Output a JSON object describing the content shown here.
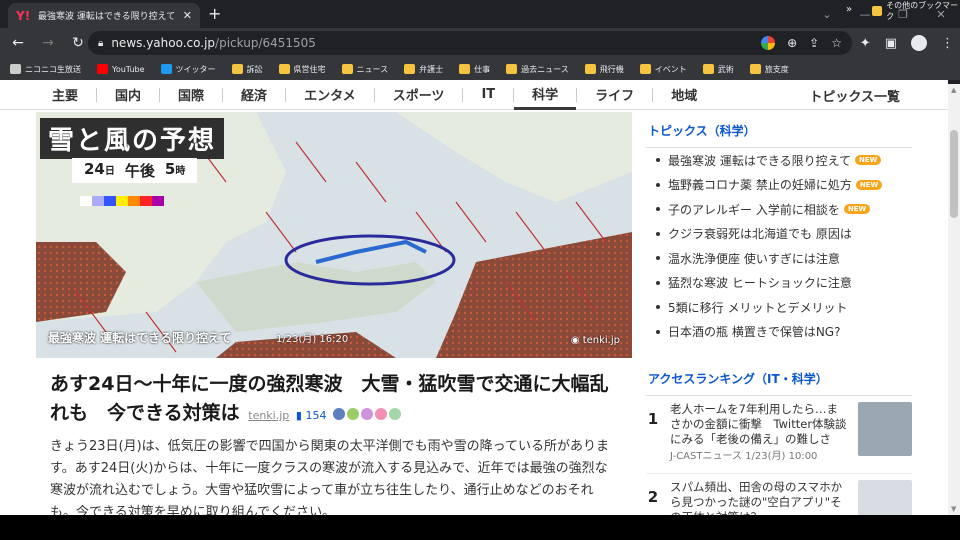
{
  "browser": {
    "tab_title": "最強寒波 運転はできる限り控えて - Yahoo",
    "url_host": "news.yahoo.co.jp",
    "url_path": "/pickup/6451505",
    "bookmarks": [
      {
        "label": "ニコニコ生放送",
        "icon": "niconico-icon",
        "color": "#cccccc"
      },
      {
        "label": "YouTube",
        "icon": "youtube-icon",
        "color": "#ff0000"
      },
      {
        "label": "ツイッター",
        "icon": "twitter-icon",
        "color": "#1d9bf0"
      },
      {
        "label": "訴訟",
        "icon": "folder-icon"
      },
      {
        "label": "県営住宅",
        "icon": "folder-icon"
      },
      {
        "label": "ニュース",
        "icon": "folder-icon"
      },
      {
        "label": "弁護士",
        "icon": "folder-icon"
      },
      {
        "label": "仕事",
        "icon": "folder-icon"
      },
      {
        "label": "過去ニュース",
        "icon": "folder-icon"
      },
      {
        "label": "飛行機",
        "icon": "folder-icon"
      },
      {
        "label": "イベント",
        "icon": "folder-icon"
      },
      {
        "label": "武術",
        "icon": "folder-icon"
      },
      {
        "label": "旅支度",
        "icon": "folder-icon"
      }
    ],
    "bookmarks_more": "»",
    "other_bookmarks": "その他のブックマーク"
  },
  "nav": {
    "categories": [
      "主要",
      "国内",
      "国際",
      "経済",
      "エンタメ",
      "スポーツ",
      "IT",
      "科学",
      "ライフ",
      "地域"
    ],
    "active": "科学",
    "topics_all": "トピックス一覧"
  },
  "hero": {
    "title": "雪と風の予想",
    "day": "24",
    "day_unit": "日",
    "ampm": "午後",
    "hour": "5",
    "hour_unit": "時",
    "caption": "最強寒波 運転はできる限り控えて",
    "time": "1/23(月) 16:20",
    "credit": "tenki.jp",
    "scale_colors": [
      "#ffffff",
      "#aaaaff",
      "#3355ff",
      "#ffee00",
      "#ff8800",
      "#ff2222",
      "#aa00aa"
    ]
  },
  "article": {
    "title": "あす24日〜十年に一度の強烈寒波　大雪・猛吹雪で交通に大幅乱れも　今できる対策は",
    "source": "tenki.jp",
    "comments": "154",
    "body": "きょう23日(月)は、低気圧の影響で四国から関東の太平洋側でも雨や雪の降っている所があります。あす24日(火)からは、十年に一度クラスの寒波が流入する見込みで、近年では最強の強烈な寒波が流れ込むでしょう。大雪や猛吹雪によって車が立ち往生したり、通行止めなどのおそれも。今できる対策を早めに取り組んでください。"
  },
  "sidebar": {
    "topics_heading": "トピックス（科学）",
    "new_label": "NEW",
    "topics": [
      {
        "text": "最強寒波 運転はできる限り控えて",
        "new": true
      },
      {
        "text": "塩野義コロナ薬 禁止の妊婦に処方",
        "new": true
      },
      {
        "text": "子のアレルギー 入学前に相談を",
        "new": true
      },
      {
        "text": "クジラ衰弱死は北海道でも 原因は",
        "new": false
      },
      {
        "text": "温水洗浄便座 使いすぎには注意",
        "new": false
      },
      {
        "text": "猛烈な寒波 ヒートショックに注意",
        "new": false
      },
      {
        "text": "5類に移行 メリットとデメリット",
        "new": false
      },
      {
        "text": "日本酒の瓶 横置きで保管はNG?",
        "new": false
      }
    ],
    "ranking_heading": "アクセスランキング（IT・科学）",
    "ranking": [
      {
        "num": "1",
        "title": "老人ホームを7年利用したら…まさかの金額に衝撃　Twitter体験談にみる「老後の備え」の難しさ",
        "meta": "J-CASTニュース 1/23(月) 10:00"
      },
      {
        "num": "2",
        "title": "スパム頻出、田舎の母のスマホから見つかった謎の\"空白アプリ\"その正体と対策は？",
        "meta": ""
      }
    ]
  }
}
